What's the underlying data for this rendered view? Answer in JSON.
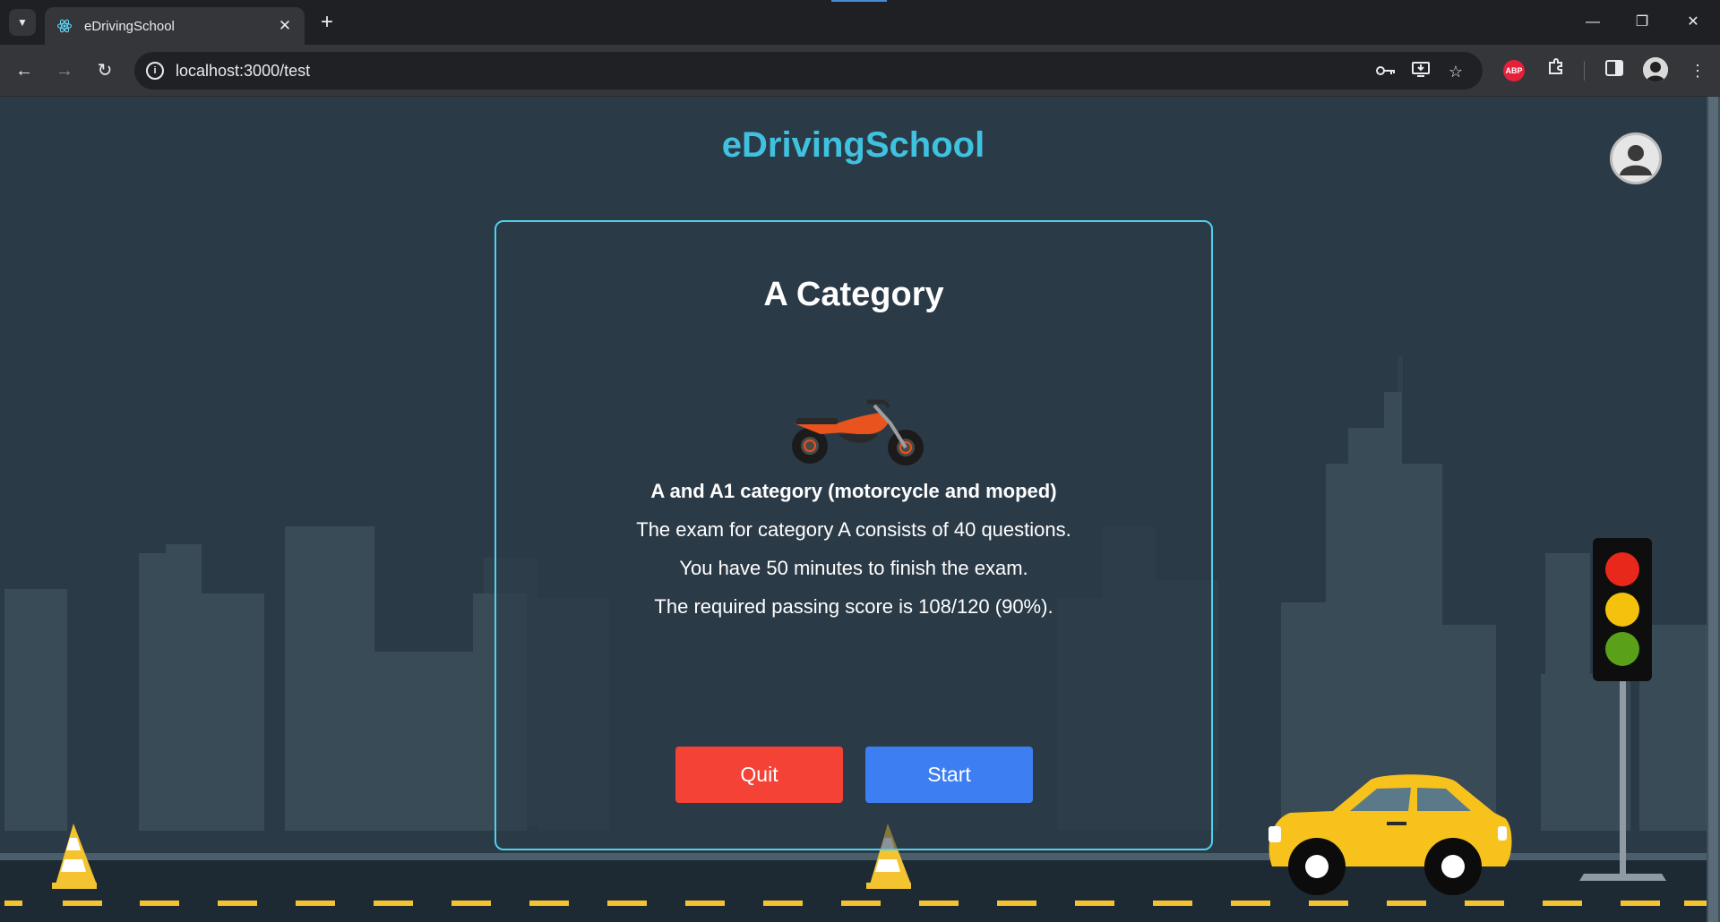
{
  "browser": {
    "tab_title": "eDrivingSchool",
    "url": "localhost:3000/test"
  },
  "header": {
    "brand": "eDrivingSchool"
  },
  "card": {
    "title": "A Category",
    "subtitle": "A and A1 category (motorcycle and moped)",
    "questions_text": "The exam for category A consists of 40 questions.",
    "time_text": "You have 50 minutes to finish the exam.",
    "score_text": "The required passing score is 108/120 (90%).",
    "quit_label": "Quit",
    "start_label": "Start"
  },
  "colors": {
    "brand": "#3fc1e0",
    "background": "#2b3a47",
    "card_border": "#4fd0ec",
    "quit": "#f44336",
    "start": "#3d7ff2"
  },
  "icons": {
    "favicon": "react-atom-icon",
    "motorcycle": "motorcycle-illustration",
    "traffic_light": "traffic-light-illustration",
    "car": "taxi-car-illustration"
  }
}
